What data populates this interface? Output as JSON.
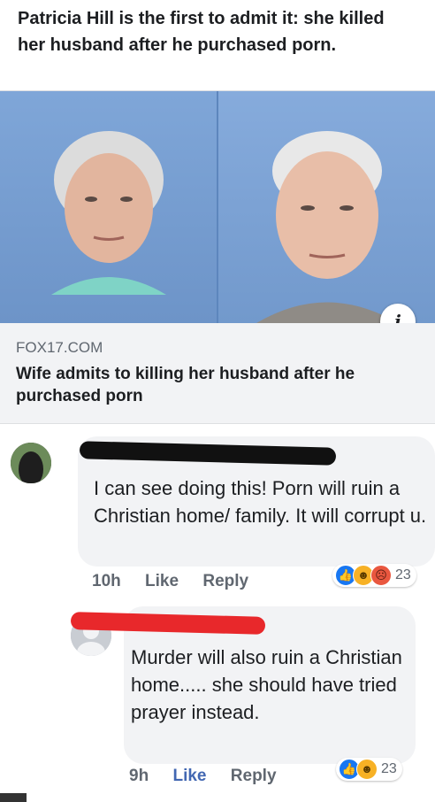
{
  "post": {
    "text": "Patricia Hill is the first to admit it: she killed her husband after he purchased porn."
  },
  "link_card": {
    "domain": "FOX17.COM",
    "title": "Wife admits to killing her husband after he purchased porn",
    "info_icon": "info-icon"
  },
  "comments": [
    {
      "text": "I can see doing this! Porn will ruin a Christian home/ family. It will corrupt u.",
      "time": "10h",
      "like_label": "Like",
      "reply_label": "Reply",
      "reactions": [
        "like",
        "haha",
        "angry"
      ],
      "reaction_count": "23"
    },
    {
      "text": "Murder will also ruin a Christian home..... she should have tried prayer instead.",
      "time": "9h",
      "like_label": "Like",
      "reply_label": "Reply",
      "reactions": [
        "like",
        "haha"
      ],
      "reaction_count": "23"
    }
  ],
  "colors": {
    "link_blue": "#4267b2",
    "like_reaction": "#1877f2",
    "haha_reaction": "#f7b125",
    "angry_reaction": "#e9573f",
    "redaction_black": "#111111",
    "redaction_red": "#e8282b"
  }
}
